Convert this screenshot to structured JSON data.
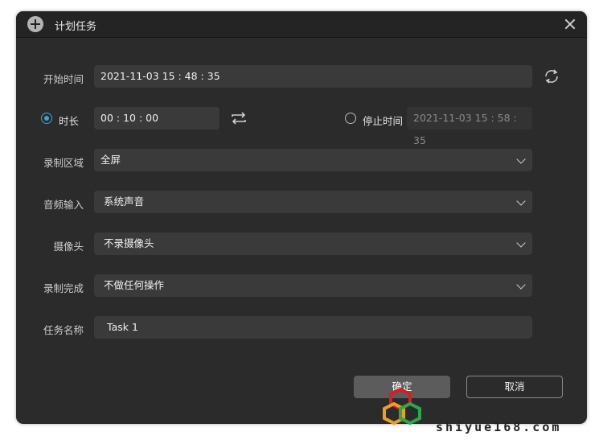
{
  "window": {
    "title": "计划任务"
  },
  "form": {
    "start_time": {
      "label": "开始时间",
      "value": "2021-11-03 15 : 48 : 35"
    },
    "duration": {
      "label": "时长",
      "value": "00 : 10 : 00",
      "selected": true
    },
    "stop_time": {
      "label": "停止时间",
      "value": "2021-11-03 15 : 58 : 35",
      "selected": false
    },
    "record_area": {
      "label": "录制区域",
      "value": "全屏"
    },
    "audio_input": {
      "label": "音频输入",
      "value": "系统声音"
    },
    "camera": {
      "label": "摄像头",
      "value": "不录摄像头"
    },
    "on_complete": {
      "label": "录制完成",
      "value": "不做任何操作"
    },
    "task_name": {
      "label": "任务名称",
      "value": "Task 1"
    }
  },
  "buttons": {
    "confirm": "确定",
    "cancel": "取消"
  },
  "watermark": {
    "text": "shiyue168.com"
  },
  "colors": {
    "dialog_bg": "#2b2b2b",
    "field_bg": "#3a3a3a",
    "accent": "#35a7e0"
  }
}
